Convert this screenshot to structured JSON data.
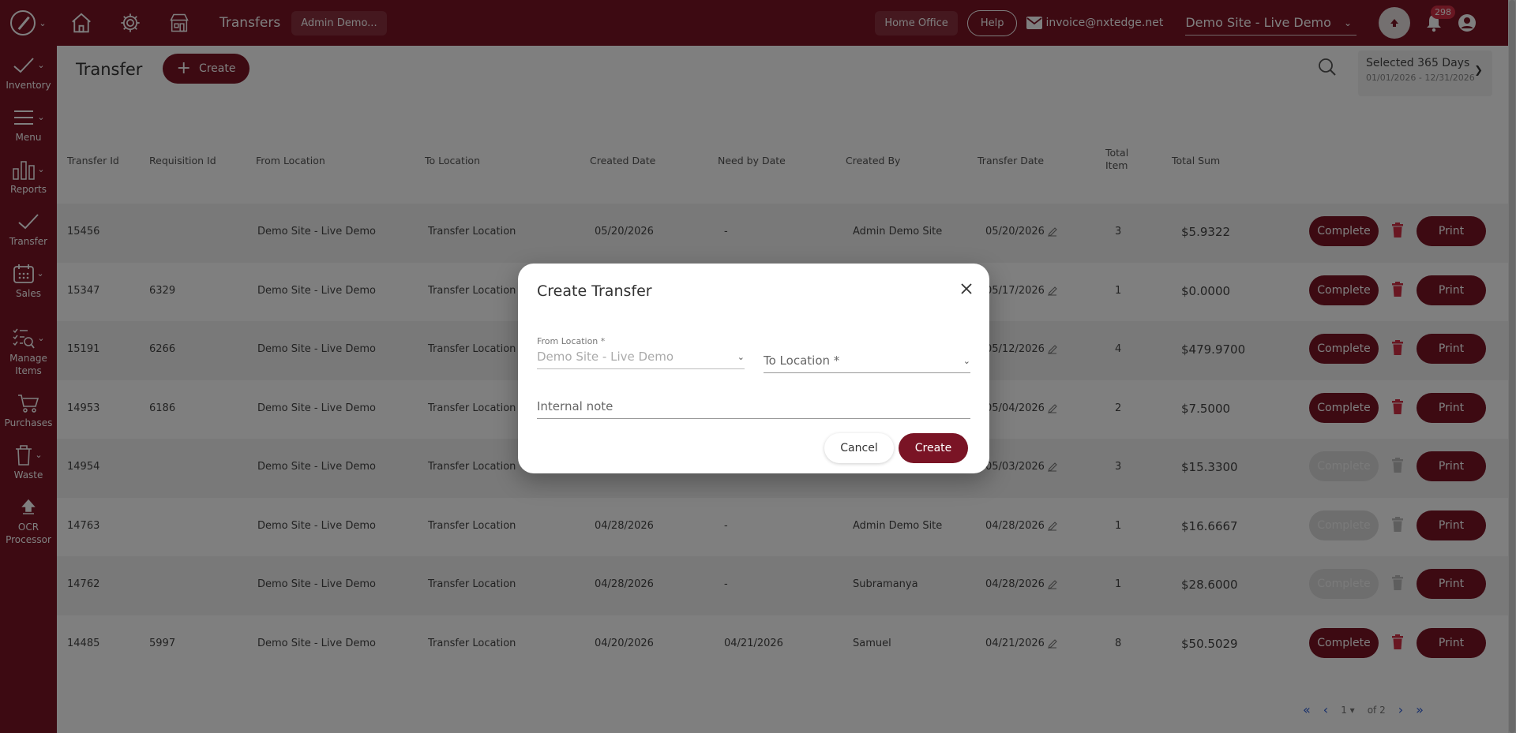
{
  "topbar": {
    "section_title": "Transfers",
    "user_chip": "Admin Demo...",
    "home_office": "Home Office",
    "help": "Help",
    "email": "invoice@nxtedge.net",
    "site": "Demo Site - Live Demo",
    "notification_count": "298"
  },
  "sidebar": {
    "inventory": "Inventory",
    "menu": "Menu",
    "reports": "Reports",
    "transfer": "Transfer",
    "sales": "Sales",
    "manage_1": "Manage",
    "manage_2": "Items",
    "purchases": "Purchases",
    "waste": "Waste",
    "ocr_1": "OCR",
    "ocr_2": "Processor"
  },
  "page": {
    "title": "Transfer",
    "create_label": "Create",
    "date_range_title": "Selected 365 Days",
    "date_range_dates": "01/01/2026 - 12/31/2026"
  },
  "table": {
    "headers": {
      "transfer_id": "Transfer Id",
      "requisition_id": "Requisition Id",
      "from_location": "From Location",
      "to_location": "To Location",
      "created_date": "Created Date",
      "need_by_date": "Need by Date",
      "created_by": "Created By",
      "transfer_date": "Transfer Date",
      "total_item_1": "Total",
      "total_item_2": "Item",
      "total_sum": "Total Sum"
    },
    "complete_label": "Complete",
    "print_label": "Print",
    "rows": [
      {
        "id": "15456",
        "req": "",
        "from": "Demo Site - Live Demo",
        "to": "Transfer Location",
        "created": "05/20/2026",
        "need": "-",
        "by": "Admin Demo Site",
        "tdate": "05/20/2026",
        "items": "3",
        "sum": "$5.9322",
        "enabled": true
      },
      {
        "id": "15347",
        "req": "6329",
        "from": "Demo Site - Live Demo",
        "to": "Transfer Location",
        "created": "",
        "need": "",
        "by": "",
        "tdate": "05/17/2026",
        "items": "1",
        "sum": "$0.0000",
        "enabled": true
      },
      {
        "id": "15191",
        "req": "6266",
        "from": "Demo Site - Live Demo",
        "to": "Transfer Location",
        "created": "",
        "need": "",
        "by": "",
        "tdate": "05/12/2026",
        "items": "4",
        "sum": "$479.9700",
        "enabled": true
      },
      {
        "id": "14953",
        "req": "6186",
        "from": "Demo Site - Live Demo",
        "to": "Transfer Location",
        "created": "",
        "need": "",
        "by": "",
        "tdate": "05/04/2026",
        "items": "2",
        "sum": "$7.5000",
        "enabled": true
      },
      {
        "id": "14954",
        "req": "",
        "from": "Demo Site - Live Demo",
        "to": "Transfer Location",
        "created": "",
        "need": "",
        "by": "",
        "tdate": "05/03/2026",
        "items": "3",
        "sum": "$15.3300",
        "enabled": false
      },
      {
        "id": "14763",
        "req": "",
        "from": "Demo Site - Live Demo",
        "to": "Transfer Location",
        "created": "04/28/2026",
        "need": "-",
        "by": "Admin Demo Site",
        "tdate": "04/28/2026",
        "items": "1",
        "sum": "$16.6667",
        "enabled": false
      },
      {
        "id": "14762",
        "req": "",
        "from": "Demo Site - Live Demo",
        "to": "Transfer Location",
        "created": "04/28/2026",
        "need": "-",
        "by": "Subramanya",
        "tdate": "04/28/2026",
        "items": "1",
        "sum": "$28.6000",
        "enabled": false
      },
      {
        "id": "14485",
        "req": "5997",
        "from": "Demo Site - Live Demo",
        "to": "Transfer Location",
        "created": "04/20/2026",
        "need": "04/21/2026",
        "by": "Samuel",
        "tdate": "04/21/2026",
        "items": "8",
        "sum": "$50.5029",
        "enabled": true
      }
    ]
  },
  "pager": {
    "page": "1",
    "of": "of 2"
  },
  "dialog": {
    "title": "Create Transfer",
    "from_label": "From Location *",
    "from_value": "Demo Site - Live Demo",
    "to_placeholder": "To Location *",
    "note_placeholder": "Internal note",
    "cancel": "Cancel",
    "create": "Create"
  },
  "colors": {
    "brand": "#7a1425",
    "delete": "#d32f45",
    "pager": "#2b5bd7"
  }
}
